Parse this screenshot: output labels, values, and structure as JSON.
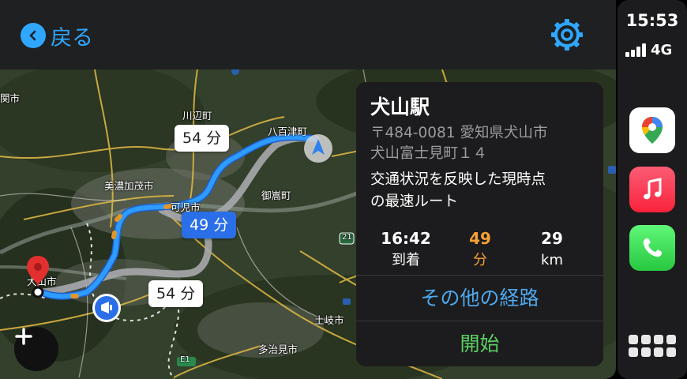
{
  "header": {
    "back_label": "戻る",
    "back_icon": "chevron-left-icon",
    "settings_icon": "gear-icon",
    "accent_color": "#2fa7ff"
  },
  "map": {
    "places": [
      "関市",
      "川辺町",
      "八百津町",
      "美濃加茂市",
      "可児市",
      "御嵩町",
      "大山市",
      "土岐市",
      "多治見市"
    ],
    "road_shields": [
      "21",
      "E1"
    ],
    "route_bubbles": {
      "alt_north": "54 分",
      "main": "49 分",
      "alt_south": "54 分"
    },
    "zoom_in_label": "+"
  },
  "card": {
    "destination": "犬山駅",
    "address_line1": "〒484-0081 愛知県犬山市",
    "address_line2": "犬山富士見町１４",
    "desc_line1": "交通状況を反映した現時点",
    "desc_line2": "の最速ルート",
    "stats": {
      "arrival_value": "16:42",
      "arrival_unit": "到着",
      "duration_value": "49",
      "duration_unit": "分",
      "distance_value": "29",
      "distance_unit": "km"
    },
    "other_routes_label": "その他の経路",
    "start_label": "開始",
    "colors": {
      "duration": "#f7a035",
      "other_routes": "#4ea8ee",
      "start": "#5ccf62"
    }
  },
  "dock": {
    "time": "15:53",
    "network": "4G",
    "apps": [
      "google-maps-icon",
      "music-icon",
      "phone-icon",
      "app-grid-icon"
    ]
  }
}
